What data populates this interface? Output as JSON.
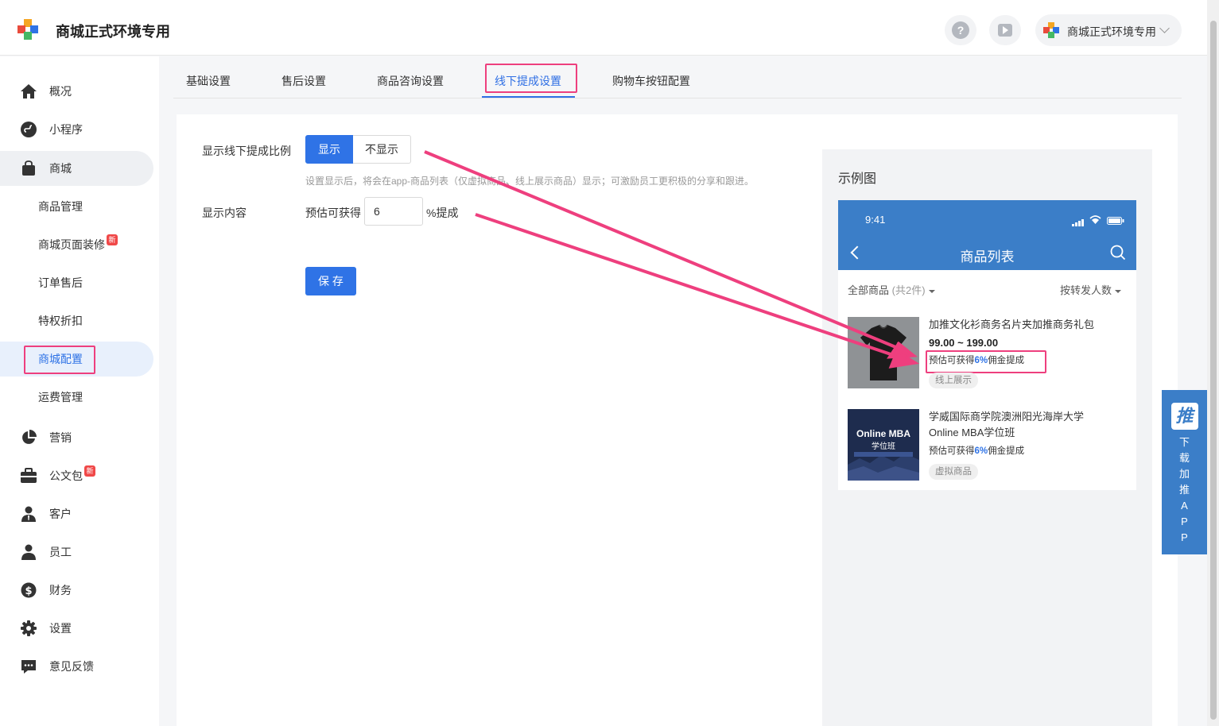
{
  "header": {
    "app_title": "商城正式环境专用",
    "account_name": "商城正式环境专用",
    "help_icon_label": "?"
  },
  "sidebar": {
    "items": [
      {
        "label": "概况",
        "icon": "home-icon"
      },
      {
        "label": "小程序",
        "icon": "mini-program-icon"
      },
      {
        "label": "商城",
        "icon": "shopping-bag-icon"
      },
      {
        "label": "营销",
        "icon": "pie-chart-icon"
      },
      {
        "label": "公文包",
        "icon": "briefcase-icon",
        "badge": "新"
      },
      {
        "label": "客户",
        "icon": "customer-icon"
      },
      {
        "label": "员工",
        "icon": "user-icon"
      },
      {
        "label": "财务",
        "icon": "dollar-icon"
      },
      {
        "label": "设置",
        "icon": "gear-icon"
      },
      {
        "label": "意见反馈",
        "icon": "feedback-icon"
      }
    ],
    "mall_sub_items": [
      {
        "label": "商品管理"
      },
      {
        "label": "商城页面装修",
        "badge": "新"
      },
      {
        "label": "订单售后"
      },
      {
        "label": "特权折扣"
      },
      {
        "label": "商城配置",
        "selected": true
      },
      {
        "label": "运费管理"
      }
    ]
  },
  "tabs": [
    {
      "label": "基础设置"
    },
    {
      "label": "售后设置"
    },
    {
      "label": "商品咨询设置"
    },
    {
      "label": "线下提成设置",
      "active": true
    },
    {
      "label": "购物车按钮配置"
    }
  ],
  "form": {
    "show_ratio_label": "显示线下提成比例",
    "show_option": "显示",
    "hide_option": "不显示",
    "hint": "设置显示后，将会在app-商品列表（仅虚拟商品、线上展示商品）显示；可激励员工更积极的分享和跟进。",
    "content_label": "显示内容",
    "prefix": "预估可获得",
    "value": "6",
    "suffix": "%提成",
    "save_button": "保 存"
  },
  "example": {
    "title": "示例图",
    "status_time": "9:41",
    "page_title": "商品列表",
    "filter_all": "全部商品",
    "filter_count": "(共2件)",
    "sort_label": "按转发人数",
    "products": [
      {
        "name": "加推文化衫商务名片夹加推商务礼包",
        "price": "99.00 ~ 199.00",
        "est_prefix": "预估可获得",
        "est_value": "6%",
        "est_suffix": "佣金提成",
        "tag": "线上展示"
      },
      {
        "name_line1": "学威国际商学院澳洲阳光海岸大学",
        "name_line2": "Online MBA学位班",
        "est_prefix": "预估可获得",
        "est_value": "6%",
        "est_suffix": "佣金提成",
        "tag": "虚拟商品",
        "thumb_text1": "Online MBA",
        "thumb_text2": "学位班"
      }
    ]
  },
  "float_download": {
    "logo": "推",
    "chars": [
      "下",
      "载",
      "加",
      "推",
      "A",
      "P",
      "P"
    ]
  },
  "colors": {
    "primary": "#2f73e6",
    "highlight": "#ee3f7e",
    "phone_header": "#3b7ec8"
  }
}
